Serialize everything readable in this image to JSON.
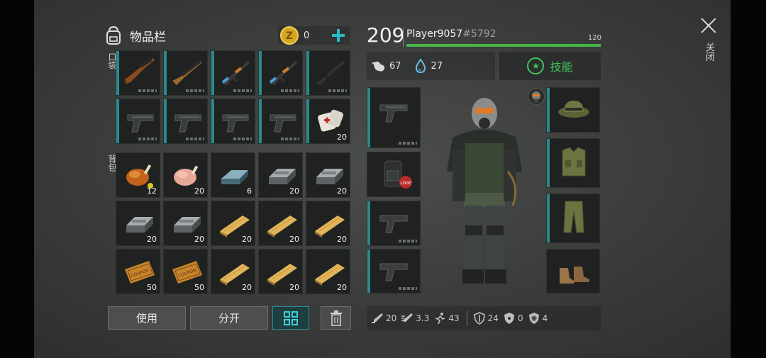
{
  "header": {
    "title": "物品栏",
    "coins": "0"
  },
  "labels": {
    "pocket": "口袋",
    "backpack": "背包"
  },
  "pocket": [
    {
      "icon": "rifle-scoped",
      "qty": ""
    },
    {
      "icon": "shotgun",
      "qty": ""
    },
    {
      "icon": "assault-rifle-camo",
      "qty": ""
    },
    {
      "icon": "assault-rifle-camo",
      "qty": ""
    },
    {
      "icon": "smg",
      "qty": ""
    },
    {
      "icon": "pistol",
      "qty": ""
    },
    {
      "icon": "pistol",
      "qty": ""
    },
    {
      "icon": "pistol",
      "qty": ""
    },
    {
      "icon": "pistol",
      "qty": ""
    },
    {
      "icon": "bandage",
      "qty": "20"
    }
  ],
  "backpack": [
    {
      "icon": "roast-chicken",
      "qty": "12"
    },
    {
      "icon": "raw-chicken",
      "qty": "20"
    },
    {
      "icon": "steel-ingot",
      "qty": "6"
    },
    {
      "icon": "iron-ingot",
      "qty": "20"
    },
    {
      "icon": "iron-ingot",
      "qty": "20"
    },
    {
      "icon": "iron-ingot",
      "qty": "20"
    },
    {
      "icon": "iron-ingot",
      "qty": "20"
    },
    {
      "icon": "wood-plank",
      "qty": "20"
    },
    {
      "icon": "wood-plank",
      "qty": "20"
    },
    {
      "icon": "wood-plank",
      "qty": "20"
    },
    {
      "icon": "coupon",
      "qty": "50"
    },
    {
      "icon": "coupon",
      "qty": "50"
    },
    {
      "icon": "wood-plank",
      "qty": "20"
    },
    {
      "icon": "wood-plank",
      "qty": "20"
    },
    {
      "icon": "wood-plank",
      "qty": "20"
    }
  ],
  "buttons": {
    "use": "使用",
    "split": "分开"
  },
  "player": {
    "level": "209",
    "name": "Player9057",
    "tag": "#5792",
    "xp_max": "120",
    "xp_fraction": 1.0
  },
  "status": {
    "food": "67",
    "water": "27"
  },
  "skills_label": "技能",
  "stats": {
    "melee": "20",
    "attack_speed": "3.3",
    "speed": "43",
    "armor": "24",
    "radiation": "0",
    "cold": "4"
  },
  "close_label": "关闭",
  "colors": {
    "accent": "#2ab9c8",
    "pocket_bar": "#2a8a8f",
    "xp": "#45b54a",
    "skills": "#3ec35c"
  }
}
